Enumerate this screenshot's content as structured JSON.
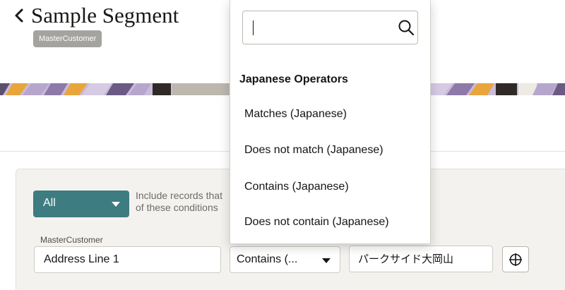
{
  "header": {
    "title": "Sample Segment",
    "object_badge": "MasterCustomer"
  },
  "criteria": {
    "match_mode": "All",
    "match_hint_line1": "Include records that",
    "match_hint_line2": "of these conditions",
    "field_label": "MasterCustomer",
    "attribute": "Address Line 1",
    "operator": "Contains (...",
    "value": "パークサイド大岡山"
  },
  "operator_dropdown": {
    "search": {
      "value": "",
      "placeholder": ""
    },
    "group_header": "Japanese Operators",
    "options": [
      "Matches (Japanese)",
      "Does not match (Japanese)",
      "Contains (Japanese)",
      "Does not contain (Japanese)"
    ]
  },
  "colors": {
    "accent": "#3d7c80",
    "badge": "#a5a3a0",
    "card_bg": "#f4f2ee",
    "banner_purple": "#b7a6cc",
    "banner_orange": "#e8a53c"
  },
  "icons": {
    "back": "chevron-left-icon",
    "search": "search-icon",
    "picker": "crosshair-icon"
  }
}
